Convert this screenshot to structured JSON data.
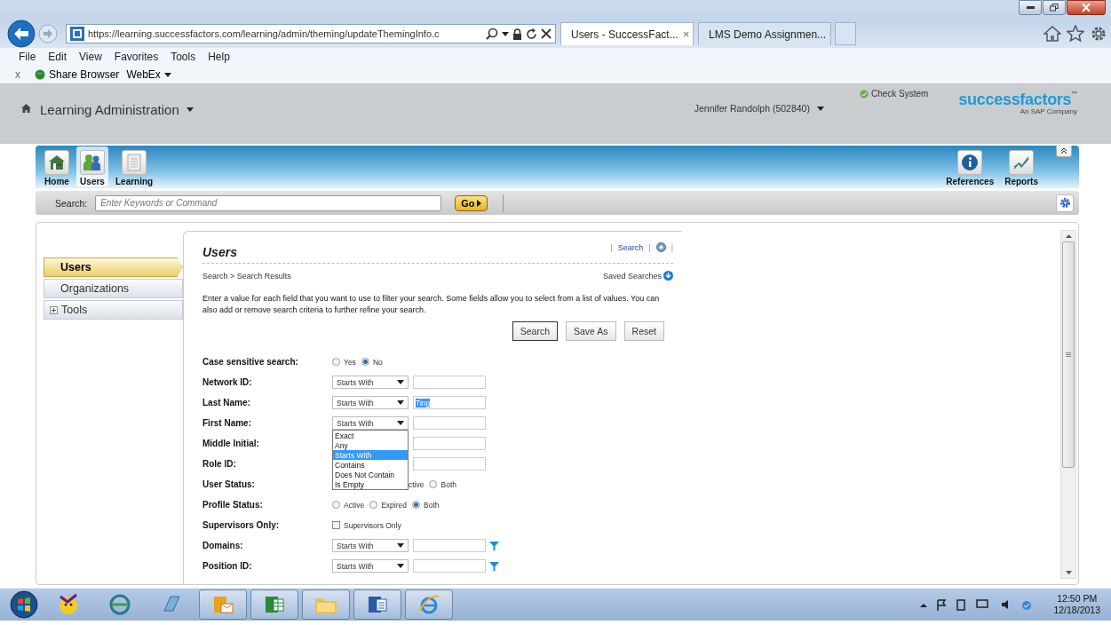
{
  "browser": {
    "address": "https://learning.successfactors.com/learning/admin/theming/updateThemingInfo.c",
    "tabs": [
      {
        "label": "Users - SuccessFact...",
        "selected": true,
        "close": "×"
      },
      {
        "label": "LMS Demo Assignmen...",
        "selected": false
      }
    ],
    "menu": [
      "File",
      "Edit",
      "View",
      "Favorites",
      "Tools",
      "Help"
    ],
    "favorites_close": "x",
    "favorites": [
      {
        "label": "Share Browser",
        "kind": "link"
      },
      {
        "label": "WebEx",
        "kind": "menu"
      }
    ]
  },
  "header": {
    "title": "Learning Administration",
    "user": "Jennifer Randolph (502840)",
    "check_system": "Check System",
    "logo": "successfactors",
    "logo_tm": "™",
    "tagline": "An SAP Company"
  },
  "nav": {
    "left": [
      {
        "label": "Home",
        "kind": "home",
        "selected": false
      },
      {
        "label": "Users",
        "kind": "users",
        "selected": true
      },
      {
        "label": "Learning",
        "kind": "document",
        "selected": false
      }
    ],
    "right": [
      {
        "label": "References",
        "kind": "info",
        "selected": false
      },
      {
        "label": "Reports",
        "kind": "chart",
        "selected": false
      }
    ]
  },
  "search": {
    "label": "Search:",
    "placeholder": "Enter Keywords or Command",
    "go": "Go"
  },
  "sidebar": [
    {
      "label": "Users",
      "selected": true
    },
    {
      "label": "Organizations",
      "selected": false
    },
    {
      "label": "Tools",
      "selected": false,
      "expandable": true
    }
  ],
  "panel": {
    "title": "Users",
    "separator": "|",
    "links": [
      "Search"
    ],
    "breadcrumb": "Search > Search Results",
    "saved_searches": "Saved Searches",
    "intro": "Enter a value for each field that you want to use to filter your search. Some fields allow you to select from a list of values. You can also add or remove search criteria to further refine your search.",
    "buttons": [
      {
        "label": "Search",
        "default": true
      },
      {
        "label": "Save As",
        "default": false
      },
      {
        "label": "Reset",
        "default": false
      }
    ],
    "fields": [
      {
        "label": "Case sensitive search:",
        "kind": "radio",
        "options": [
          {
            "kind": "radio",
            "label": "Yes",
            "selected": false
          },
          {
            "kind": "radio",
            "label": "No",
            "selected": true
          }
        ]
      },
      {
        "label": "Network ID:",
        "kind": "select",
        "operator": "Starts With"
      },
      {
        "label": "Last Name:",
        "kind": "select",
        "operator": "Starts With",
        "value": "Ting",
        "value_selected": true
      },
      {
        "label": "First Name:",
        "kind": "select",
        "operator": "Starts With",
        "open": true,
        "options": [
          {
            "label": "Exact",
            "selected": false
          },
          {
            "label": "Any",
            "selected": false
          },
          {
            "label": "Starts With",
            "selected": true
          },
          {
            "label": "Contains",
            "selected": false
          },
          {
            "label": "Does Not Contain",
            "selected": false
          },
          {
            "label": "Is Empty",
            "selected": false
          }
        ]
      },
      {
        "label": "Middle Initial:",
        "kind": "input"
      },
      {
        "label": "Role ID:",
        "kind": "input"
      },
      {
        "label": "User Status:",
        "kind": "radio",
        "options": [
          {
            "kind": "text",
            "label": "ctive"
          },
          {
            "kind": "radio",
            "label": "Both",
            "selected": false
          }
        ]
      },
      {
        "label": "Profile Status:",
        "kind": "radio",
        "options": [
          {
            "kind": "radio",
            "label": "Active",
            "selected": false
          },
          {
            "kind": "radio",
            "label": "Expired",
            "selected": false
          },
          {
            "kind": "radio",
            "label": "Both",
            "selected": true
          }
        ]
      },
      {
        "label": "Supervisors Only:",
        "kind": "checkbox",
        "text": "Supervisors Only",
        "checked": false
      },
      {
        "label": "Domains:",
        "kind": "select",
        "operator": "Starts With",
        "filter": true
      },
      {
        "label": "Position ID:",
        "kind": "select",
        "operator": "Starts With",
        "filter": true
      }
    ]
  },
  "taskbar": {
    "apps": [
      {
        "kind": "smiley",
        "running": false
      },
      {
        "kind": "globe",
        "running": false
      },
      {
        "kind": "notebook",
        "running": false
      },
      {
        "kind": "envelope",
        "running": true
      },
      {
        "kind": "spreadsheet",
        "running": true
      },
      {
        "kind": "folder",
        "running": true
      },
      {
        "kind": "document",
        "running": true
      },
      {
        "kind": "browser",
        "running": true
      }
    ],
    "time": "12:50 PM",
    "date": "12/18/2013"
  }
}
